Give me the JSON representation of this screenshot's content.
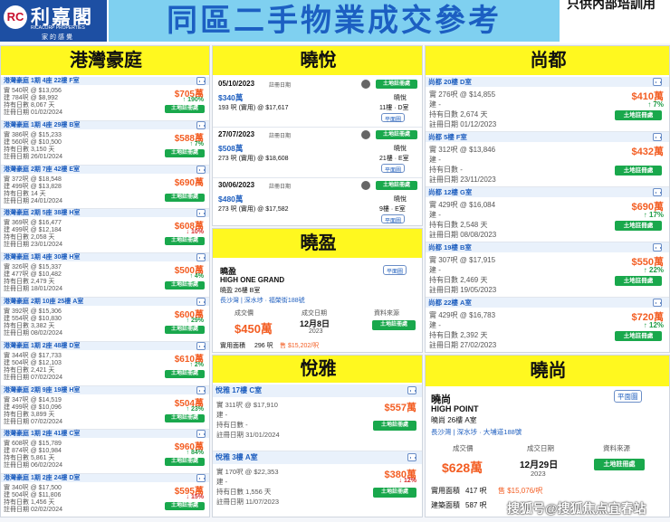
{
  "header": {
    "logo_mark": "RC",
    "logo_name": "利嘉閣",
    "logo_en": "RICACORP PROPERTIES",
    "logo_sub": "家的感覺",
    "title": "同區二手物業成交參考",
    "note": "只供內部培訓用"
  },
  "col1": {
    "title": "港灣豪庭",
    "rows": [
      {
        "head": "港灣豪庭 1期 4座 22樓 F室",
        "l1": "實 540呎 @ $13,056",
        "l2": "建 784呎 @ $8,992",
        "l3": "持有日數 8,067 天",
        "l4": "註冊日期 01/02/2024",
        "price": "$705萬",
        "chg": "↑ 190%",
        "up": true
      },
      {
        "head": "港灣豪庭 1期 4座 29樓 B室",
        "l1": "實 386呎 @ $15,233",
        "l2": "建 560呎 @ $10,500",
        "l3": "持有日數 3,150 天",
        "l4": "註冊日期 26/01/2024",
        "price": "$588萬",
        "chg": "↑ 7%",
        "up": true
      },
      {
        "head": "港灣豪庭 2期 7座 42樓 E室",
        "l1": "實 372呎 @ $18,548",
        "l2": "建 499呎 @ $13,828",
        "l3": "持有日數 14 天",
        "l4": "註冊日期 24/01/2024",
        "price": "$690萬",
        "chg": "",
        "up": true
      },
      {
        "head": "港灣豪庭 2期 5座 38樓 H室",
        "l1": "實 369呎 @ $16,477",
        "l2": "建 499呎 @ $12,184",
        "l3": "持有日數 2,058 天",
        "l4": "註冊日期 23/01/2024",
        "price": "$608萬",
        "chg": "↓ 10%",
        "up": false
      },
      {
        "head": "港灣豪庭 1期 4座 30樓 H室",
        "l1": "實 326呎 @ $15,337",
        "l2": "建 477呎 @ $10,482",
        "l3": "持有日數 2,479 天",
        "l4": "註冊日期 18/01/2024",
        "price": "$500萬",
        "chg": "↑ 4%",
        "up": true
      },
      {
        "head": "港灣豪庭 2期 10座 25樓 A室",
        "l1": "實 392呎 @ $15,306",
        "l2": "建 554呎 @ $10,830",
        "l3": "持有日數 3,382 天",
        "l4": "註冊日期 08/02/2024",
        "price": "$600萬",
        "chg": "↑ 29%",
        "up": true
      },
      {
        "head": "港灣豪庭 1期 2座 48樓 D室",
        "l1": "實 344呎 @ $17,733",
        "l2": "建 504呎 @ $12,103",
        "l3": "持有日數 2,421 天",
        "l4": "註冊日期 07/02/2024",
        "price": "$610萬",
        "chg": "↑ 2%",
        "up": true
      },
      {
        "head": "港灣豪庭 2期 9座 19樓 H室",
        "l1": "實 347呎 @ $14,519",
        "l2": "建 499呎 @ $10,096",
        "l3": "持有日數 3,899 天",
        "l4": "註冊日期 07/02/2024",
        "price": "$504萬",
        "chg": "↑ 23%",
        "up": true
      },
      {
        "head": "港灣豪庭 1期 2座 41樓 C室",
        "l1": "實 608呎 @ $15,789",
        "l2": "建 874呎 @ $10,984",
        "l3": "持有日數 5,861 天",
        "l4": "註冊日期 06/02/2024",
        "price": "$960萬",
        "chg": "↑ 84%",
        "up": true
      },
      {
        "head": "港灣豪庭 1期 2座 24樓 D室",
        "l1": "實 340呎 @ $17,500",
        "l2": "建 504呎 @ $11,806",
        "l3": "持有日數 1,456 天",
        "l4": "註冊日期 02/02/2024",
        "price": "$595萬",
        "chg": "↓ 15%",
        "up": false
      }
    ]
  },
  "col2": {
    "title": "曉悅",
    "rows": [
      {
        "date": "05/10/2023",
        "date_label": "註冊日期",
        "price": "$340萬",
        "estate": "曉悅",
        "area": "193 呎 (實用) @ $17,617",
        "unit": "11樓 · D室"
      },
      {
        "date": "27/07/2023",
        "date_label": "註冊日期",
        "price": "$508萬",
        "estate": "曉悅",
        "area": "273 呎 (實用) @ $18,608",
        "unit": "21樓 · E室"
      },
      {
        "date": "30/06/2023",
        "date_label": "註冊日期",
        "price": "$480萬",
        "estate": "曉悅",
        "area": "273 呎 (實用) @ $17,582",
        "unit": "9樓 · E室"
      }
    ],
    "land_btn": "土地註冊處",
    "plan_btn": "平面圖"
  },
  "col2b": {
    "title": "曉盈",
    "name": "曉盈",
    "en": "HIGH ONE GRAND",
    "unit": "曉盈 26樓 B室",
    "addr": "長沙灣 | 深水埗 · 福榮街188號",
    "plan": "平面圖",
    "h1": "成交價",
    "h2": "成交日期",
    "h3": "資料來源",
    "price": "$450萬",
    "day": "12月8日",
    "year": "2023",
    "btn": "土地註冊處",
    "area_label": "實用面積",
    "area": "296 呎",
    "psf": "售 $15,202/呎"
  },
  "col2c": {
    "title": "悅雅",
    "rows": [
      {
        "head": "悅雅 17樓 C室",
        "l1": "實 311呎 @ $17,910",
        "l2": "建 -",
        "l3": "持有日數 -",
        "l4": "註冊日期 31/01/2024",
        "price": "$557萬",
        "chg": ""
      },
      {
        "head": "悅雅 3樓 A室",
        "l1": "實 170呎 @ $22,353",
        "l2": "建 -",
        "l3": "持有日數 1,556 天",
        "l4": "註冊日期 11/07/2023",
        "price": "$380萬",
        "chg": "↓ 12%"
      }
    ],
    "btn": "土地註冊處"
  },
  "col3": {
    "title": "尚都",
    "rows": [
      {
        "head": "尚都 20樓 D室",
        "l1": "實 276呎 @ $14,855",
        "l2": "建 -",
        "l3": "持有日數 2,674 天",
        "l4": "註冊日期 01/12/2023",
        "price": "$410萬",
        "chg": "↑ 7%",
        "up": true
      },
      {
        "head": "尚都 5樓 F室",
        "l1": "實 312呎 @ $13,846",
        "l2": "建 -",
        "l3": "持有日數 -",
        "l4": "註冊日期 23/11/2023",
        "price": "$432萬",
        "chg": "",
        "up": true
      },
      {
        "head": "尚都 12樓 G室",
        "l1": "實 429呎 @ $16,084",
        "l2": "建 -",
        "l3": "持有日數 2,548 天",
        "l4": "註冊日期 08/08/2023",
        "price": "$690萬",
        "chg": "↑ 17%",
        "up": true
      },
      {
        "head": "尚都 19樓 B室",
        "l1": "實 307呎 @ $17,915",
        "l2": "建 -",
        "l3": "持有日數 2,469 天",
        "l4": "註冊日期 19/05/2023",
        "price": "$550萬",
        "chg": "↑ 22%",
        "up": true
      },
      {
        "head": "尚都 22樓 A室",
        "l1": "實 429呎 @ $16,783",
        "l2": "建 -",
        "l3": "持有日數 2,392 天",
        "l4": "註冊日期 27/02/2023",
        "price": "$720萬",
        "chg": "↑ 12%",
        "up": true
      }
    ],
    "btn": "土地註冊處"
  },
  "col3b": {
    "title": "曉尚",
    "name": "曉尚",
    "en": "HIGH POINT",
    "unit": "曉尚 26樓 A室",
    "addr": "長沙灣 | 深水埗 · 大埔道188號",
    "plan": "平面圖",
    "h1": "成交價",
    "h2": "成交日期",
    "h3": "資料來源",
    "price": "$628萬",
    "day": "12月29日",
    "year": "2023",
    "btn": "土地註冊處",
    "area_label": "實用面積",
    "area": "417 呎",
    "psf": "售 $15,076/呎",
    "area2_label": "建築面積",
    "area2": "587 呎"
  },
  "watermark": "搜狐号@搜狐焦点宜春站"
}
